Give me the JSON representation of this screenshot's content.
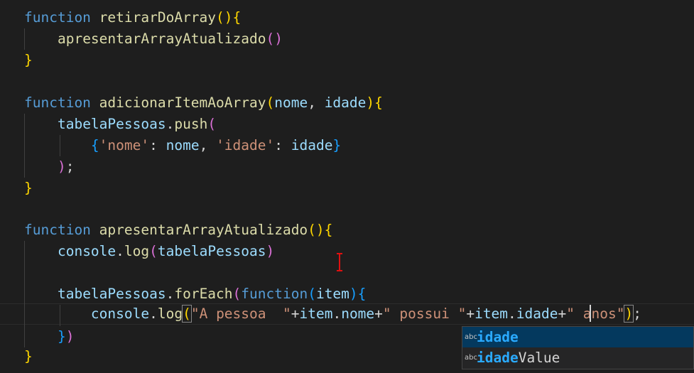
{
  "code": {
    "line1": {
      "kw": "function",
      "name": "retirarDoArray",
      "open": "()",
      "brace": "{"
    },
    "line2": {
      "call": "apresentarArrayAtualizado",
      "parens": "()"
    },
    "line3": {
      "brace": "}"
    },
    "line5": {
      "kw": "function",
      "name": "adicionarItemAoArray",
      "lparen": "(",
      "p1": "nome",
      "comma": ", ",
      "p2": "idade",
      "rparen": ")",
      "brace": "{"
    },
    "line6": {
      "obj": "tabelaPessoas",
      "dot": ".",
      "method": "push",
      "lparen": "("
    },
    "line7": {
      "lbrace": "{",
      "k1": "'nome'",
      "colon1": ": ",
      "v1": "nome",
      "comma": ", ",
      "k2": "'idade'",
      "colon2": ": ",
      "v2": "idade",
      "rbrace": "}"
    },
    "line8": {
      "rparen": ")",
      "semi": ";"
    },
    "line9": {
      "brace": "}"
    },
    "line11": {
      "kw": "function",
      "name": "apresentarArrayAtualizado",
      "open": "()",
      "brace": "{"
    },
    "line12": {
      "obj": "console",
      "dot": ".",
      "method": "log",
      "lparen": "(",
      "arg": "tabelaPessoas",
      "rparen": ")"
    },
    "line14": {
      "obj": "tabelaPessoas",
      "dot": ".",
      "method": "forEach",
      "lparen": "(",
      "kw": "function",
      "lparen2": "(",
      "param": "item",
      "rparen2": ")",
      "brace": "{"
    },
    "line15": {
      "obj": "console",
      "dot": ".",
      "method": "log",
      "lparen": "(",
      "s1": "\"A pessoa  \"",
      "plus1": "+",
      "o1": "item",
      "dot1": ".",
      "f1": "nome",
      "plus2": "+",
      "s2": "\" possui \"",
      "plus3": "+",
      "o2": "item",
      "dot2": ".",
      "f2": "idade",
      "plus4": "+",
      "s3": "\" anos\"",
      "rparen": ")",
      "semi": ";"
    },
    "line16": {
      "rbrace": "}",
      "rparen": ")"
    },
    "line17": {
      "brace": "}"
    }
  },
  "suggest": {
    "items": [
      {
        "icon": "abc",
        "match": "idade",
        "rest": ""
      },
      {
        "icon": "abc",
        "match": "idade",
        "rest": "Value"
      }
    ]
  },
  "colors": {
    "background": "#1e1e1e",
    "keyword": "#569cd6",
    "function": "#dcdcaa",
    "variable": "#9cdcfe",
    "string": "#ce9178",
    "bracket1": "#ffd700",
    "bracket2": "#da70d6",
    "bracket3": "#179fff",
    "suggestHighlight": "#2aaaff"
  }
}
